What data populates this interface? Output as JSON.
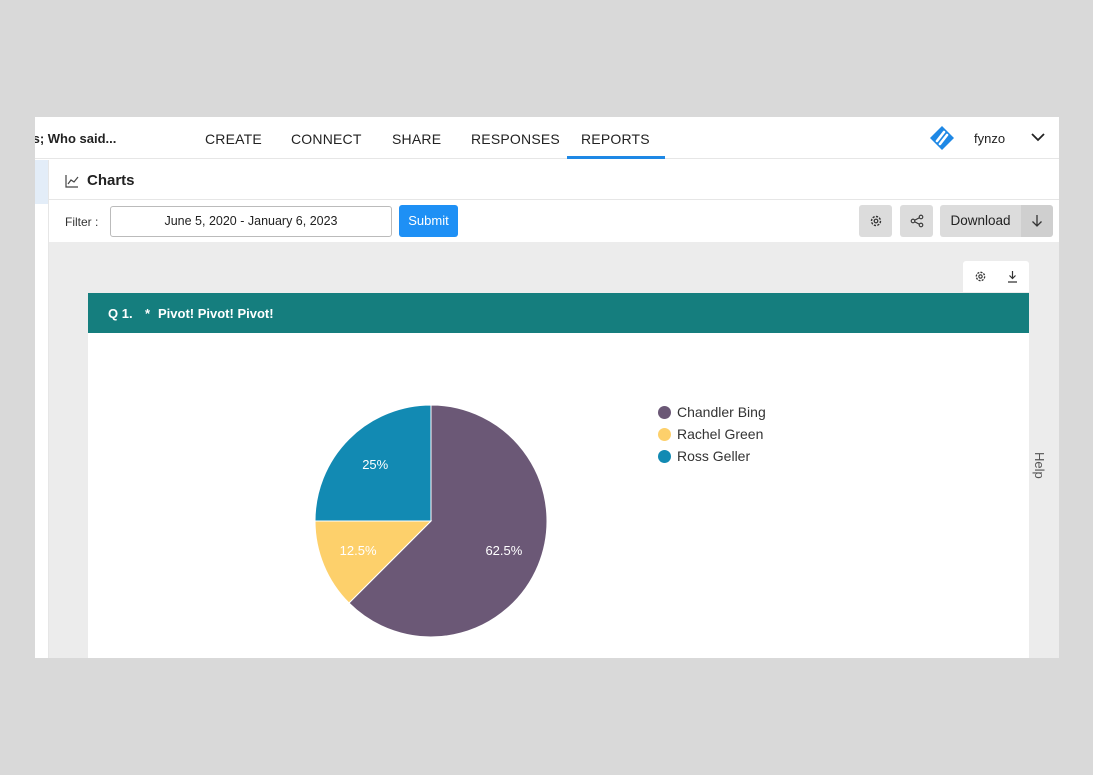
{
  "nav": {
    "survey_title": "ls; Who said...",
    "tabs": [
      {
        "label": "CREATE"
      },
      {
        "label": "CONNECT"
      },
      {
        "label": "SHARE"
      },
      {
        "label": "RESPONSES"
      },
      {
        "label": "REPORTS",
        "active": true
      }
    ],
    "user_name": "fynzo",
    "brand_color": "#1e88e5"
  },
  "charts_header": {
    "title": "Charts"
  },
  "filter": {
    "label": "Filter :",
    "date_range": "June 5, 2020 - January 6, 2023",
    "submit_label": "Submit",
    "download_label": "Download"
  },
  "question": {
    "number": "Q 1.",
    "required_marker": "*",
    "text": "Pivot! Pivot! Pivot!",
    "header_color": "#157e7e"
  },
  "help_label": "Help",
  "chart_data": {
    "type": "pie",
    "categories": [
      "Chandler Bing",
      "Rachel Green",
      "Ross Geller"
    ],
    "values": [
      62.5,
      12.5,
      25
    ],
    "labels": [
      "62.5%",
      "12.5%",
      "25%"
    ],
    "colors": [
      "#6b5876",
      "#fdd06b",
      "#128ab3"
    ],
    "legend_position": "right"
  }
}
